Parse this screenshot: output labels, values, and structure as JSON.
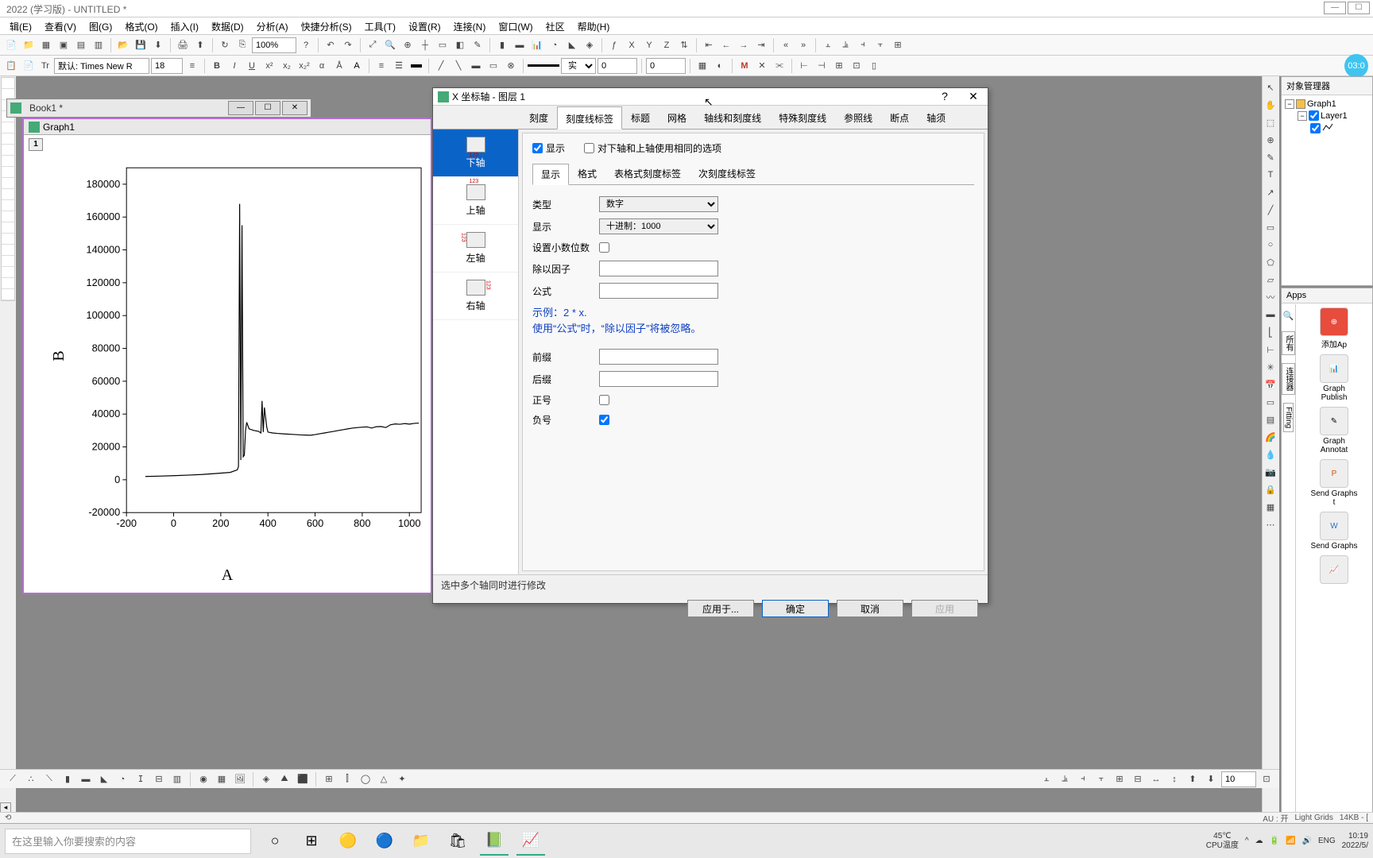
{
  "title": "2022 (学习版) - UNTITLED *",
  "menu": [
    "辑(E)",
    "查看(V)",
    "图(G)",
    "格式(O)",
    "插入(I)",
    "数据(D)",
    "分析(A)",
    "快捷分析(S)",
    "工具(T)",
    "设置(R)",
    "连接(N)",
    "窗口(W)",
    "社区",
    "帮助(H)"
  ],
  "toolbar1": {
    "zoom": "100%"
  },
  "toolbar2": {
    "font_label": "默认: Times New R",
    "font_size": "18"
  },
  "timer": "03:0",
  "book1": {
    "title": "Book1 *"
  },
  "graphwin": {
    "title": "Graph1",
    "layer": "1"
  },
  "obj_mgr": {
    "title": "对象管理器",
    "root": "Graph1",
    "child": "Layer1"
  },
  "apps": {
    "title": "Apps",
    "side": [
      "所有",
      "连接器",
      "Fitting"
    ],
    "items": [
      "添加Ap",
      "Graph Publish",
      "Graph Annotat",
      "Send Graphs t",
      "Send Graphs"
    ]
  },
  "dialog": {
    "title": "X 坐标轴 - 图层 1",
    "tabs": [
      "刻度",
      "刻度线标签",
      "标题",
      "网格",
      "轴线和刻度线",
      "特殊刻度线",
      "参照线",
      "断点",
      "轴须"
    ],
    "active_tab": 1,
    "side": [
      "下轴",
      "上轴",
      "左轴",
      "右轴"
    ],
    "check_show": "显示",
    "check_same": "对下轴和上轴使用相同的选项",
    "subtabs": [
      "显示",
      "格式",
      "表格式刻度标签",
      "次刻度线标签"
    ],
    "fields": {
      "type": "类型",
      "type_v": "数字",
      "disp": "显示",
      "disp_v": "十进制：1000",
      "dec": "设置小数位数",
      "divf": "除以因子",
      "formula": "公式",
      "example1": "示例：2 * x.",
      "example2": "使用“公式”时，“除以因子”将被忽略。",
      "prefix": "前缀",
      "suffix": "后缀",
      "plus": "正号",
      "minus": "负号"
    },
    "hint": "选中多个轴同时进行修改",
    "buttons": {
      "applyto": "应用于...",
      "ok": "确定",
      "cancel": "取消",
      "apply": "应用"
    }
  },
  "chart_data": {
    "type": "line",
    "xlabel": "A",
    "ylabel": "B",
    "xlim": [
      -200,
      1050
    ],
    "ylim": [
      -20000,
      190000
    ],
    "xticks": [
      -200,
      0,
      200,
      400,
      600,
      800,
      1000
    ],
    "yticks": [
      -20000,
      0,
      20000,
      40000,
      60000,
      80000,
      100000,
      120000,
      140000,
      160000,
      180000
    ],
    "series": [
      {
        "name": "B",
        "x": [
          -120,
          -60,
          0,
          60,
          120,
          180,
          240,
          270,
          275,
          280,
          285,
          290,
          295,
          300,
          305,
          310,
          315,
          320,
          340,
          360,
          370,
          375,
          380,
          385,
          395,
          400,
          420,
          440,
          460,
          480,
          500,
          520,
          540,
          560,
          580,
          600,
          620,
          640,
          660,
          680,
          700,
          720,
          740,
          760,
          780,
          800,
          820,
          840,
          860,
          880,
          900,
          920,
          940,
          960,
          980,
          1000,
          1020,
          1040
        ],
        "y": [
          2000,
          2200,
          2500,
          2800,
          3200,
          3800,
          4500,
          6000,
          8000,
          168000,
          12000,
          155000,
          14000,
          15000,
          30000,
          35000,
          33000,
          31000,
          30000,
          29500,
          28500,
          48000,
          29000,
          44000,
          32000,
          29000,
          28500,
          28200,
          28000,
          27800,
          27700,
          27500,
          27300,
          27200,
          27100,
          27500,
          28000,
          28500,
          29000,
          29500,
          30000,
          30500,
          31000,
          31500,
          31800,
          32000,
          32200,
          31500,
          32300,
          32400,
          31800,
          33500,
          34000,
          33800,
          34200,
          33900,
          34300,
          34500
        ]
      }
    ]
  },
  "btm_toolbar_val": "10",
  "status": {
    "au": "AU : 开",
    "grids": "Light Grids",
    "size": "14KB - ["
  },
  "taskbar": {
    "search": "在这里输入你要搜索的内容",
    "temp1": "45℃",
    "temp2": "CPU温度",
    "lang": "ENG",
    "time": "10:19",
    "date": "2022/5/"
  }
}
